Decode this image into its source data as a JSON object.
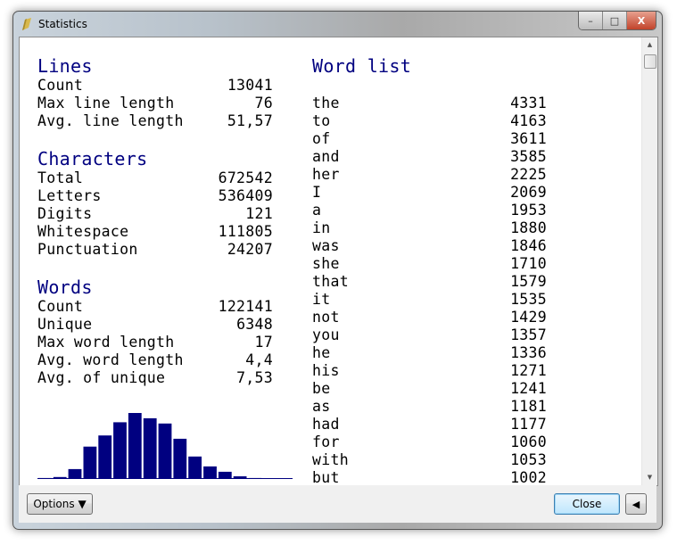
{
  "window": {
    "title": "Statistics",
    "icon": "pencil-icon",
    "controls": {
      "minimize": "–",
      "maximize": "□",
      "close": "X"
    }
  },
  "lines": {
    "heading": "Lines",
    "rows": [
      {
        "label": "Count",
        "value": "13041"
      },
      {
        "label": "Max line length",
        "value": "76"
      },
      {
        "label": "Avg. line length",
        "value": "51,57"
      }
    ]
  },
  "characters": {
    "heading": "Characters",
    "rows": [
      {
        "label": "Total",
        "value": "672542"
      },
      {
        "label": "Letters",
        "value": "536409"
      },
      {
        "label": "Digits",
        "value": "121"
      },
      {
        "label": "Whitespace",
        "value": "111805"
      },
      {
        "label": "Punctuation",
        "value": "24207"
      }
    ]
  },
  "words": {
    "heading": "Words",
    "rows": [
      {
        "label": "Count",
        "value": "122141"
      },
      {
        "label": "Unique",
        "value": "6348"
      },
      {
        "label": "Max word length",
        "value": "17"
      },
      {
        "label": "Avg. word length",
        "value": "4,4"
      },
      {
        "label": "Avg. of unique",
        "value": "7,53"
      }
    ]
  },
  "histogram": {
    "color": "#000080",
    "relative_heights": [
      1.5,
      3,
      15,
      49,
      66,
      86,
      100,
      92,
      84,
      61,
      34,
      19,
      11,
      4,
      1.5,
      0.5,
      0.5
    ]
  },
  "word_list": {
    "heading": "Word list",
    "items": [
      [
        "the",
        "4331"
      ],
      [
        "to",
        "4163"
      ],
      [
        "of",
        "3611"
      ],
      [
        "and",
        "3585"
      ],
      [
        "her",
        "2225"
      ],
      [
        "I",
        "2069"
      ],
      [
        "a",
        "1953"
      ],
      [
        "in",
        "1880"
      ],
      [
        "was",
        "1846"
      ],
      [
        "she",
        "1710"
      ],
      [
        "that",
        "1579"
      ],
      [
        "it",
        "1535"
      ],
      [
        "not",
        "1429"
      ],
      [
        "you",
        "1357"
      ],
      [
        "he",
        "1336"
      ],
      [
        "his",
        "1271"
      ],
      [
        "be",
        "1241"
      ],
      [
        "as",
        "1181"
      ],
      [
        "had",
        "1177"
      ],
      [
        "for",
        "1060"
      ],
      [
        "with",
        "1053"
      ],
      [
        "but",
        "1002"
      ]
    ]
  },
  "buttons": {
    "options": "Options ▼",
    "close": "Close",
    "back": "◀"
  },
  "scrollbar": {
    "up": "▲",
    "down": "▼"
  }
}
